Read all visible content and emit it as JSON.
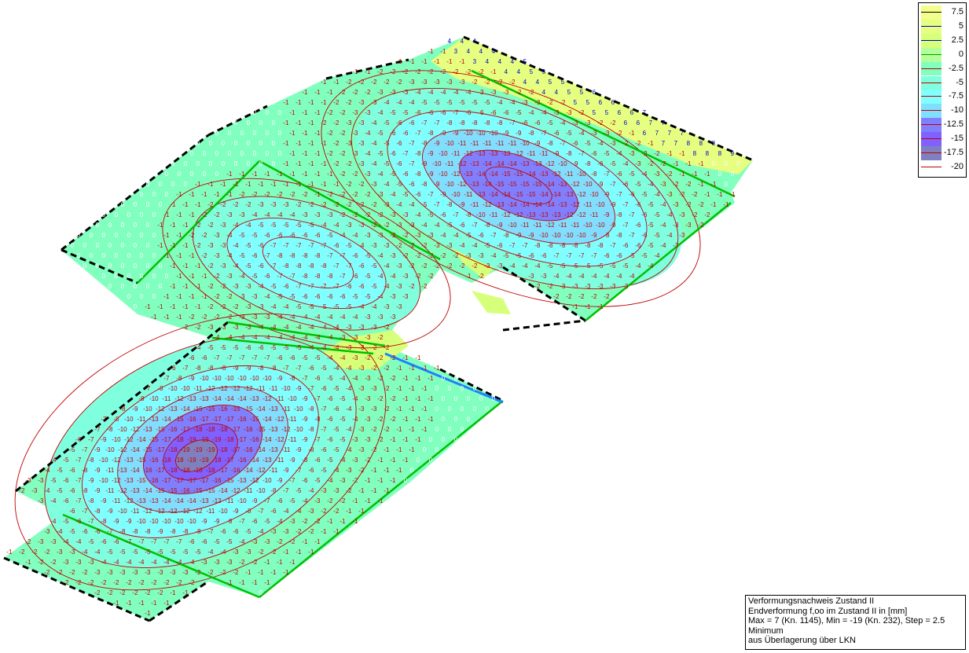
{
  "legend": {
    "entries": [
      {
        "value": "7.5",
        "fill": "#f3ff8a",
        "line": "#000000"
      },
      {
        "value": "5",
        "fill": "#e6ff80",
        "line": "#0000c0"
      },
      {
        "value": "2.5",
        "fill": "#d6ff7a",
        "line": "#0000c0"
      },
      {
        "value": "0",
        "fill": "#b4ff99",
        "line": "#00a000"
      },
      {
        "value": "-2.5",
        "fill": "#80ffbf",
        "line": "#c00000"
      },
      {
        "value": "-5",
        "fill": "#80ffdf",
        "line": "#c00000"
      },
      {
        "value": "-7.5",
        "fill": "#80ffff",
        "line": "#c00000"
      },
      {
        "value": "-10",
        "fill": "#80dfff",
        "line": "#c00000"
      },
      {
        "value": "-12.5",
        "fill": "#8080ff",
        "line": "#c00000"
      },
      {
        "value": "-15",
        "fill": "#8060ff",
        "line": "#c00000"
      },
      {
        "value": "-17.5",
        "fill": "#8080c0",
        "line": "#c00000"
      },
      {
        "value": "-20",
        "fill": "#ffffff",
        "line": "#c00000"
      }
    ]
  },
  "info": {
    "line1": "Verformungsnachweis Zustand II",
    "line2": "Endverformung f,oo im Zustand II in [mm]",
    "line3": "Max = 7 (Kn. 1145), Min = -19 (Kn. 232), Step = 2.5",
    "line4": "Minimum",
    "line5": "aus Überlagerung über LKN"
  },
  "colors": {
    "plate_base": "#80ffbf",
    "zone_light": "#80ffdf",
    "zone_cyan": "#80ffff",
    "zone_blue": "#80dfff",
    "zone_violet": "#8080ff",
    "zone_deep": "#8060ff",
    "zone_min": "#8080c0",
    "zone_yellow": "#e6ff80",
    "zone_lime": "#d6ff7a",
    "edge_support": "#00c000",
    "contour_line": "#c00000",
    "positive_label": "#0000c0",
    "negative_label": "#c00000"
  },
  "extrema": {
    "max_value": 7,
    "max_node": 1145,
    "min_value": -19,
    "min_node": 232,
    "step": 2.5
  }
}
